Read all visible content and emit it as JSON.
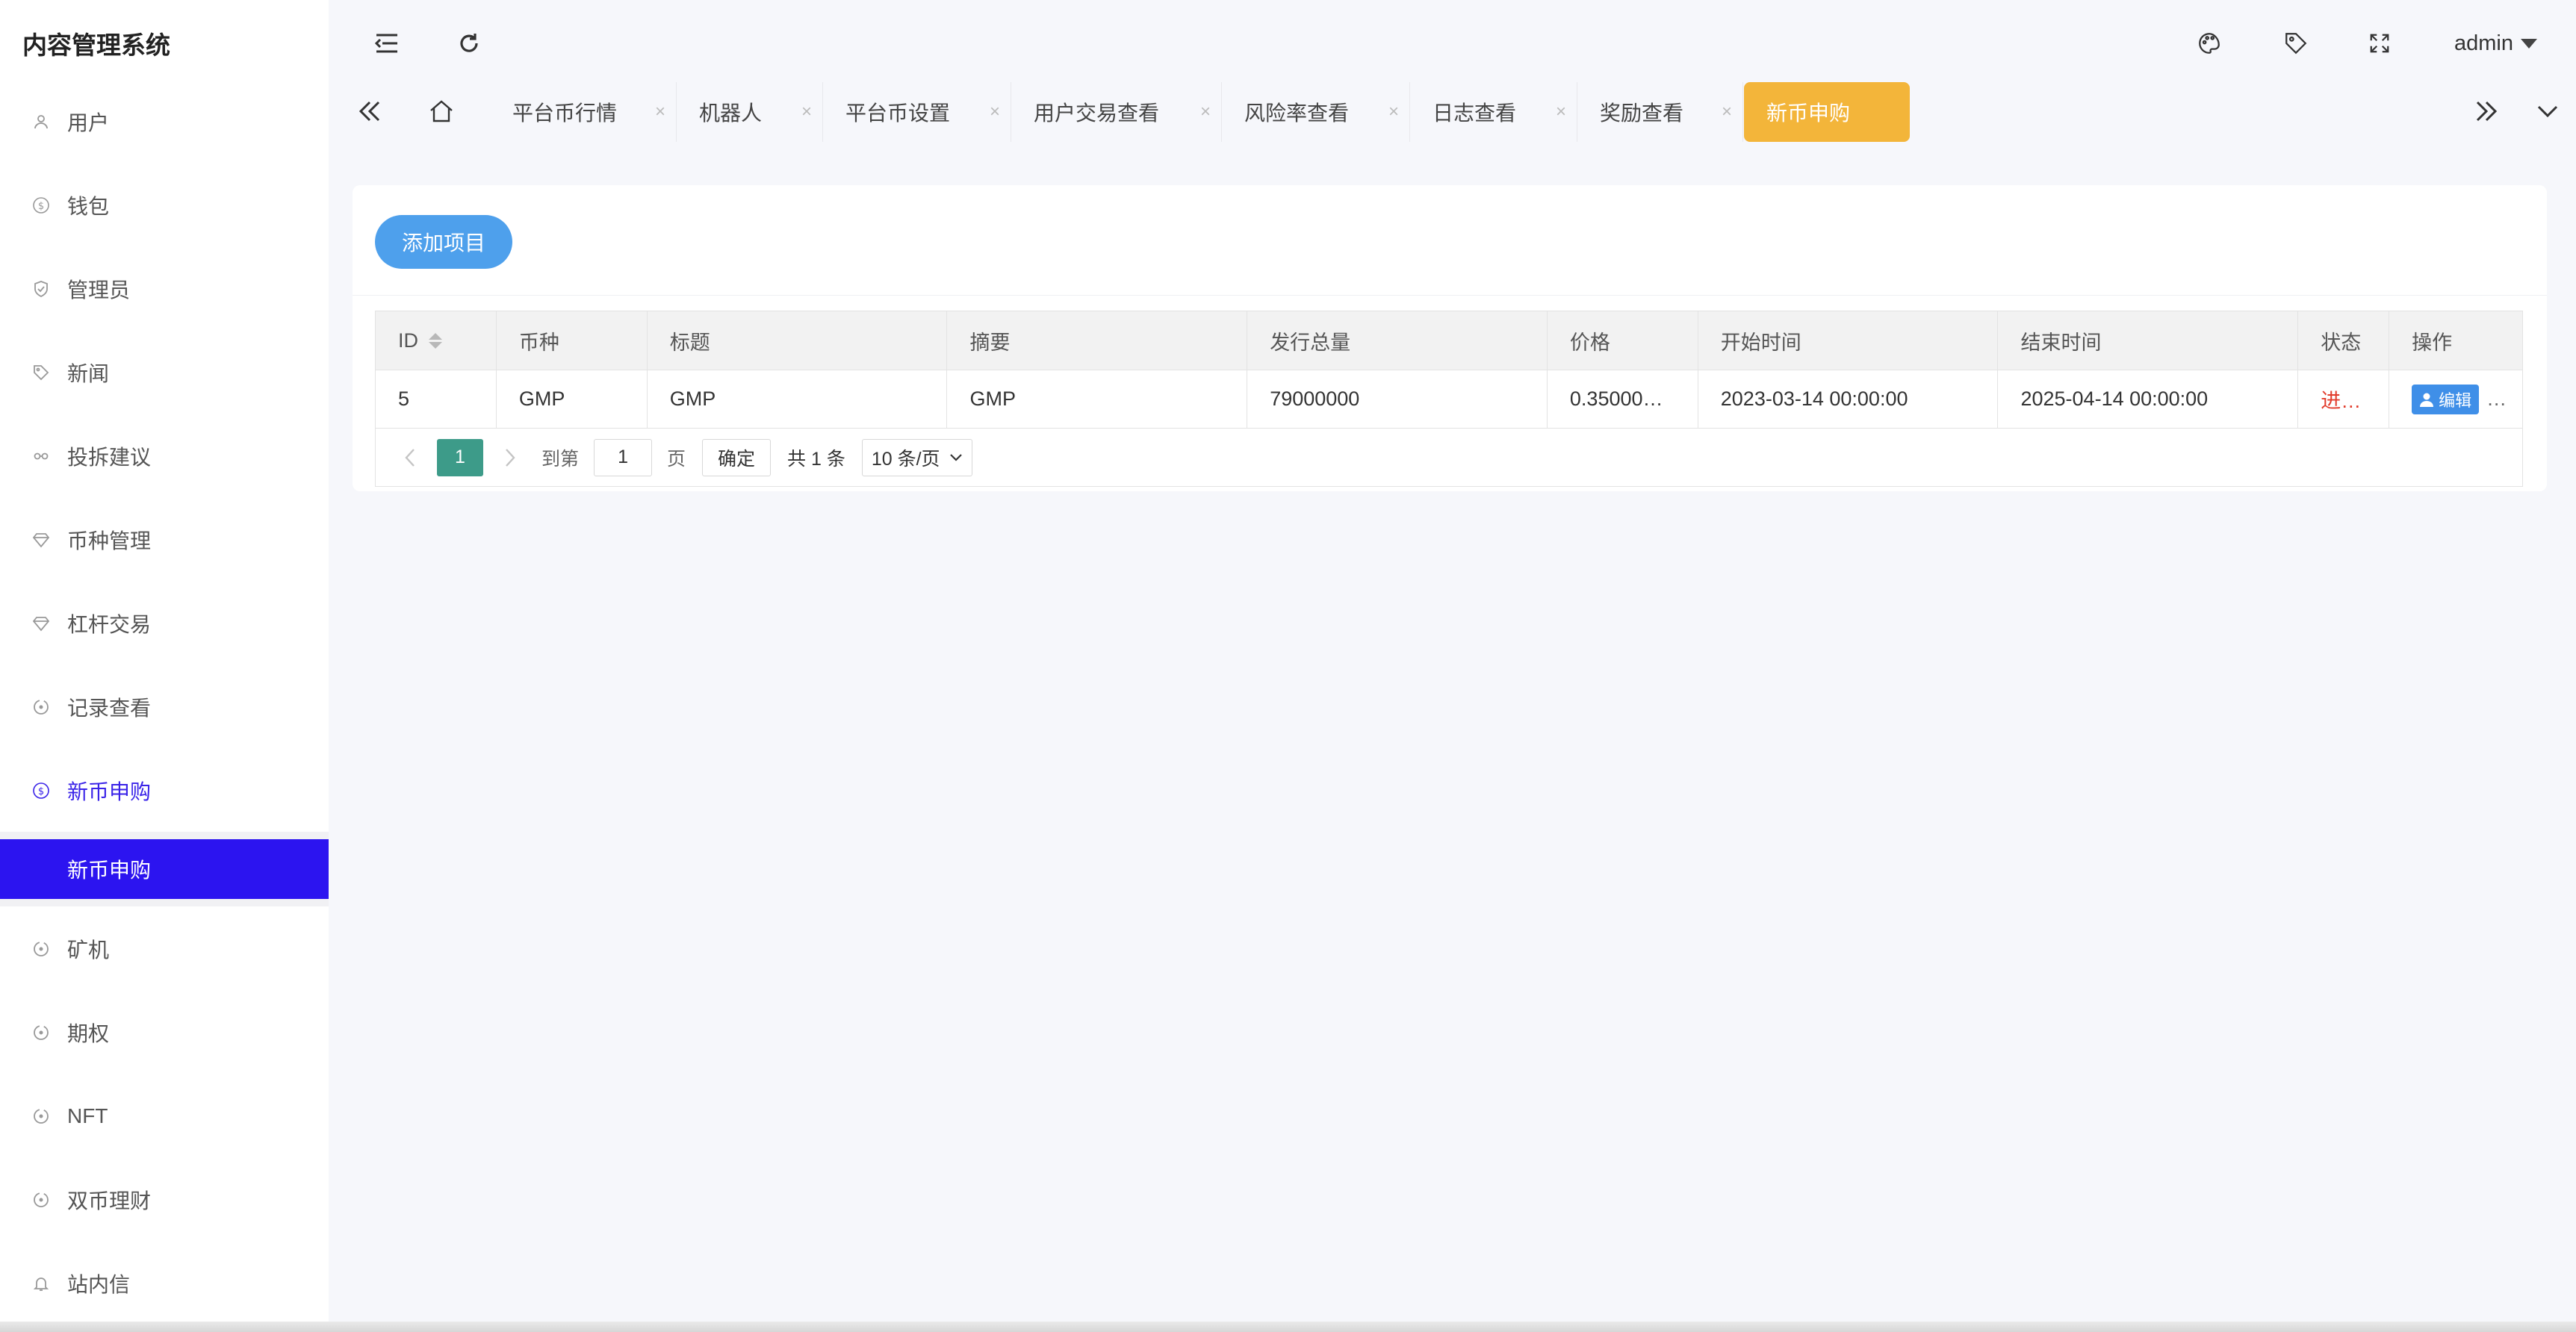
{
  "app": {
    "title": "内容管理系统"
  },
  "header": {
    "user": "admin"
  },
  "sidebar": {
    "items": [
      {
        "label": "用户",
        "icon": "user-icon"
      },
      {
        "label": "钱包",
        "icon": "dollar-icon"
      },
      {
        "label": "管理员",
        "icon": "shield-icon"
      },
      {
        "label": "新闻",
        "icon": "tag-icon"
      },
      {
        "label": "投拆建议",
        "icon": "link-icon"
      },
      {
        "label": "币种管理",
        "icon": "diamond-icon"
      },
      {
        "label": "杠杆交易",
        "icon": "diamond-icon"
      },
      {
        "label": "记录查看",
        "icon": "circle-icon"
      },
      {
        "label": "新币申购",
        "icon": "dollar-icon",
        "active": true
      },
      {
        "label": "矿机",
        "icon": "circle-icon"
      },
      {
        "label": "期权",
        "icon": "circle-icon"
      },
      {
        "label": "NFT",
        "icon": "circle-icon"
      },
      {
        "label": "双币理财",
        "icon": "circle-icon"
      },
      {
        "label": "站内信",
        "icon": "bell-icon"
      }
    ],
    "submenu_active": "新币申购"
  },
  "tabs": [
    {
      "label": "平台币行情"
    },
    {
      "label": "机器人"
    },
    {
      "label": "平台币设置"
    },
    {
      "label": "用户交易查看"
    },
    {
      "label": "风险率查看"
    },
    {
      "label": "日志查看"
    },
    {
      "label": "奖励查看"
    },
    {
      "label": "新币申购",
      "active": true
    }
  ],
  "toolbar": {
    "add_label": "添加项目"
  },
  "table": {
    "columns": [
      "ID",
      "币种",
      "标题",
      "摘要",
      "发行总量",
      "价格",
      "开始时间",
      "结束时间",
      "状态",
      "操作"
    ],
    "rows": [
      {
        "id": "5",
        "coin": "GMP",
        "title": "GMP",
        "summary": "GMP",
        "total": "79000000",
        "price": "0.35000…",
        "start": "2023-03-14 00:00:00",
        "end": "2025-04-14 00:00:00",
        "status": "进…",
        "action": "编辑",
        "more": "…"
      }
    ]
  },
  "pager": {
    "current": "1",
    "goto_label": "到第",
    "input_value": "1",
    "page_label": "页",
    "confirm": "确定",
    "total": "共 1 条",
    "page_size": "10 条/页"
  },
  "colors": {
    "active_menu": "#2c14f0",
    "active_tab": "#f3b53a",
    "add_button": "#4ea0ec",
    "pager_current": "#3d9b89",
    "status_red": "#e23b2b"
  }
}
